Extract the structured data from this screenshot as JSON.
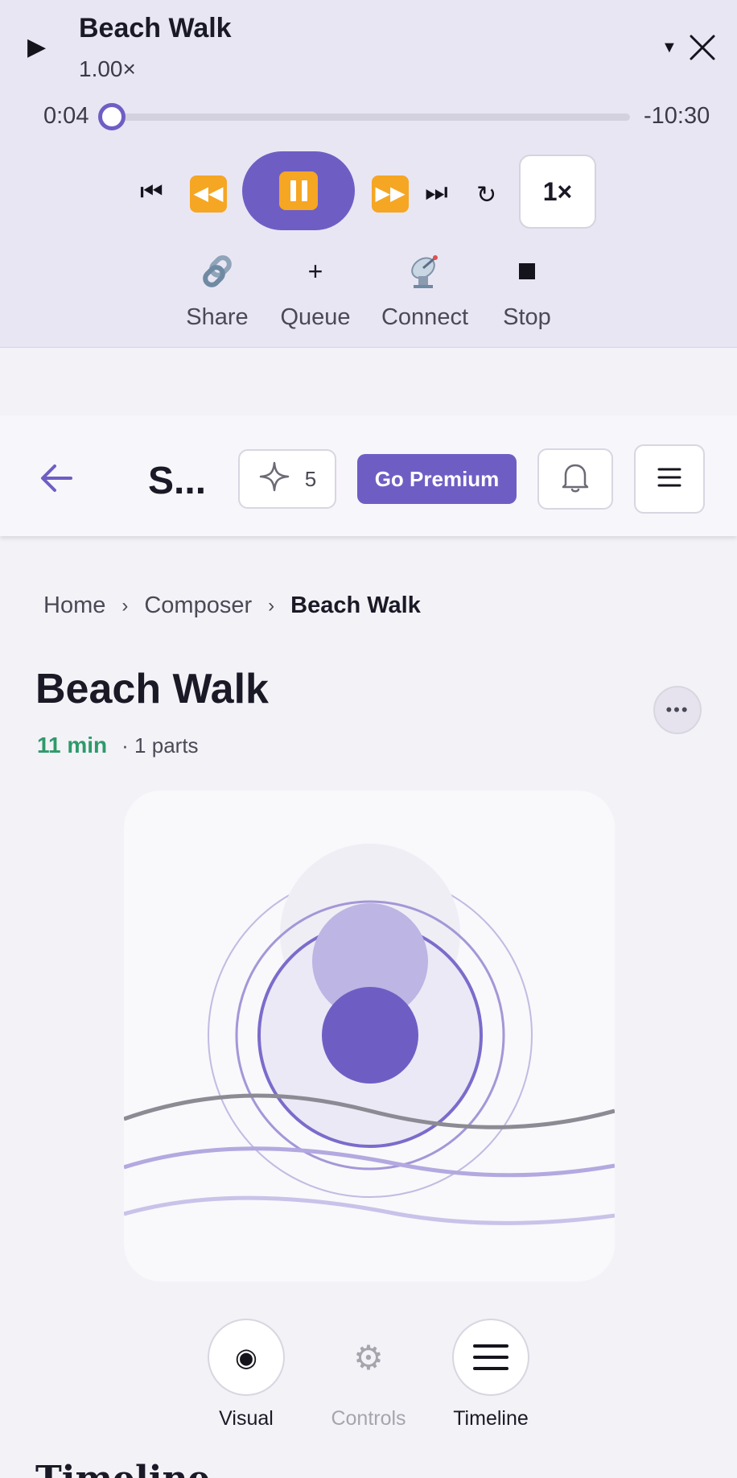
{
  "player": {
    "title": "Beach Walk",
    "rate": "1.00×",
    "elapsed": "0:04",
    "remaining": "-10:30",
    "progress": 0.006,
    "speed_label": "1×",
    "actions": [
      {
        "label": "Share",
        "icon": "link-icon"
      },
      {
        "label": "Queue",
        "icon": "plus-icon"
      },
      {
        "label": "Connect",
        "icon": "satellite-icon"
      },
      {
        "label": "Stop",
        "icon": "stop-icon"
      }
    ]
  },
  "header": {
    "title": "S...",
    "sparkle_count": "5",
    "premium_label": "Go Premium"
  },
  "breadcrumb": {
    "items": [
      "Home",
      "Composer",
      "Beach Walk"
    ],
    "separator": "›"
  },
  "page": {
    "title": "Beach Walk",
    "duration": "11 min",
    "parts": "· 1 parts"
  },
  "modes": [
    {
      "label": "Visual",
      "active": true
    },
    {
      "label": "Controls",
      "active": false
    },
    {
      "label": "Timeline",
      "active": true
    }
  ],
  "section": {
    "title": "Timeline"
  },
  "colors": {
    "accent": "#6e5ec4",
    "player_bg": "#e9e6f4",
    "duration_green": "#2e9a6a",
    "emoji_orange": "#f5a623"
  }
}
